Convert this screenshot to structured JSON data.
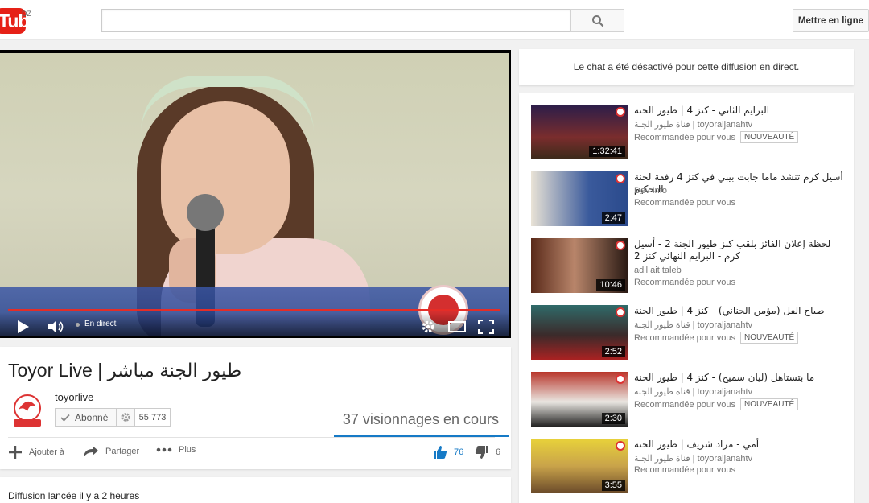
{
  "header": {
    "logo_text": "Tube",
    "country": "DZ",
    "search_placeholder": "",
    "upload_label": "Mettre en ligne"
  },
  "player": {
    "live_label": "En direct",
    "progress": 1.0
  },
  "video": {
    "title": "Toyor Live | طيور الجنة مباشر",
    "owner": "toyorlive",
    "subscribe_label": "Abonné",
    "subscriber_count": "55 773",
    "viewers": "37 visionnages en cours",
    "add_label": "Ajouter à",
    "share_label": "Partager",
    "more_label": "Plus",
    "likes": "76",
    "dislikes": "6",
    "description": "Diffusion lancée il y a 2 heures"
  },
  "chat": {
    "message": "Le chat a été désactivé pour cette diffusion en direct."
  },
  "recommendations": [
    {
      "title": "البرايم الثاني - كنز 4 | طيور الجنة",
      "channel": "قناة طيور الجنة | toyoraljanahtv",
      "meta": "Recommandée pour vous",
      "badge": "NOUVEAUTÉ",
      "duration": "1:32:41"
    },
    {
      "title": "أسيل كرم تنشد ماما جابت بيبي في كنز 4 رفقة لجنة التحكيم",
      "channel": "Dev Info",
      "meta": "Recommandée pour vous",
      "badge": "",
      "duration": "2:47"
    },
    {
      "title": "لحظة إعلان الفائز بلقب كنز طيور الجنة 2 - أسيل كرم - البرايم النهائي كنز 2",
      "channel": "adil ait taleb",
      "meta": "Recommandée pour vous",
      "badge": "",
      "duration": "10:46"
    },
    {
      "title": "صباح الفل (مؤمن الجناني) - كنز 4 | طيور الجنة",
      "channel": "قناة طيور الجنة | toyoraljanahtv",
      "meta": "Recommandée pour vous",
      "badge": "NOUVEAUTÉ",
      "duration": "2:52"
    },
    {
      "title": "ما بتستاهل (ليان سميح) - كنز 4 | طيور الجنة",
      "channel": "قناة طيور الجنة | toyoraljanahtv",
      "meta": "Recommandée pour vous",
      "badge": "NOUVEAUTÉ",
      "duration": "2:30"
    },
    {
      "title": "أمي - مراد شريف | طيور الجنة",
      "channel": "قناة طيور الجنة | toyoraljanahtv",
      "meta": "Recommandée pour vous",
      "badge": "",
      "duration": "3:55"
    }
  ],
  "colors": {
    "brand_red": "#e62117",
    "link_blue": "#167ac6",
    "progress_red": "#e52d27"
  }
}
